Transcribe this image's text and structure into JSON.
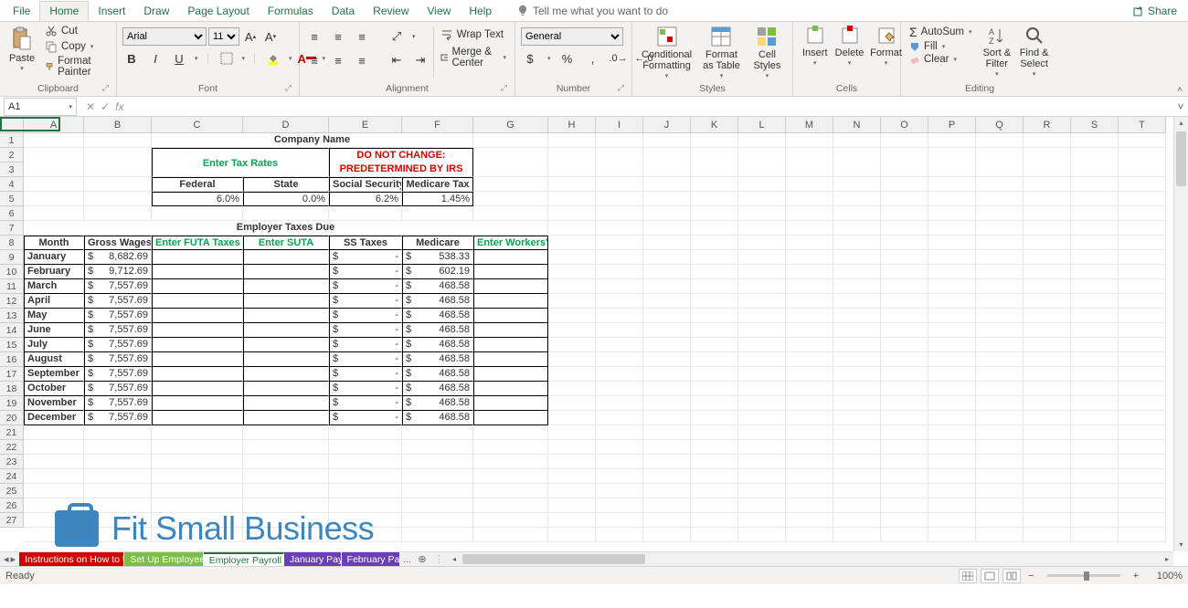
{
  "ribbon": {
    "tabs": [
      "File",
      "Home",
      "Insert",
      "Draw",
      "Page Layout",
      "Formulas",
      "Data",
      "Review",
      "View",
      "Help"
    ],
    "active_tab": "Home",
    "tellme": "Tell me what you want to do",
    "share": "Share",
    "clipboard": {
      "paste": "Paste",
      "cut": "Cut",
      "copy": "Copy",
      "format_painter": "Format Painter",
      "label": "Clipboard"
    },
    "font": {
      "name": "Arial",
      "size": "11",
      "label": "Font"
    },
    "alignment": {
      "wrap": "Wrap Text",
      "merge": "Merge & Center",
      "label": "Alignment"
    },
    "number": {
      "format": "General",
      "label": "Number"
    },
    "styles": {
      "cond": "Conditional Formatting",
      "table": "Format as Table",
      "cellstyles": "Cell Styles",
      "label": "Styles"
    },
    "cells": {
      "insert": "Insert",
      "delete": "Delete",
      "format": "Format",
      "label": "Cells"
    },
    "editing": {
      "autosum": "AutoSum",
      "fill": "Fill",
      "clear": "Clear",
      "sort": "Sort & Filter",
      "find": "Find & Select",
      "label": "Editing"
    }
  },
  "formula_bar": {
    "name_box": "A1",
    "formula": ""
  },
  "columns": [
    "A",
    "B",
    "C",
    "D",
    "E",
    "F",
    "G",
    "H",
    "I",
    "J",
    "K",
    "L",
    "M",
    "N",
    "O",
    "P",
    "Q",
    "R",
    "S",
    "T"
  ],
  "row_count": 27,
  "sheet": {
    "title": "Company Name",
    "enter_rates": "Enter Tax Rates",
    "no_change_1": "DO NOT CHANGE:",
    "no_change_2": "PREDETERMINED BY IRS",
    "headers": {
      "federal": "Federal",
      "state": "State",
      "ss": "Social Security",
      "medicare": "Medicare Tax"
    },
    "rates": {
      "federal": "6.0%",
      "state": "0.0%",
      "ss": "6.2%",
      "medicare": "1.45%"
    },
    "table_title": "Employer Taxes Due",
    "cols": {
      "month": "Month",
      "gross": "Gross Wages",
      "futa": "Enter FUTA Taxes",
      "suta": "Enter SUTA",
      "sstax": "SS Taxes",
      "med": "Medicare",
      "workers": "Enter Workers'"
    },
    "rows": [
      {
        "month": "January",
        "gross": "8,682.69",
        "ss": "-",
        "med": "538.33"
      },
      {
        "month": "February",
        "gross": "9,712.69",
        "ss": "-",
        "med": "602.19"
      },
      {
        "month": "March",
        "gross": "7,557.69",
        "ss": "-",
        "med": "468.58"
      },
      {
        "month": "April",
        "gross": "7,557.69",
        "ss": "-",
        "med": "468.58"
      },
      {
        "month": "May",
        "gross": "7,557.69",
        "ss": "-",
        "med": "468.58"
      },
      {
        "month": "June",
        "gross": "7,557.69",
        "ss": "-",
        "med": "468.58"
      },
      {
        "month": "July",
        "gross": "7,557.69",
        "ss": "-",
        "med": "468.58"
      },
      {
        "month": "August",
        "gross": "7,557.69",
        "ss": "-",
        "med": "468.58"
      },
      {
        "month": "September",
        "gross": "7,557.69",
        "ss": "-",
        "med": "468.58"
      },
      {
        "month": "October",
        "gross": "7,557.69",
        "ss": "-",
        "med": "468.58"
      },
      {
        "month": "November",
        "gross": "7,557.69",
        "ss": "-",
        "med": "468.58"
      },
      {
        "month": "December",
        "gross": "7,557.69",
        "ss": "-",
        "med": "468.58"
      }
    ]
  },
  "sheet_tabs": [
    {
      "label": "Instructions on How to Use----->",
      "color": "#d40000"
    },
    {
      "label": "Set Up Employee Data",
      "color": "#7bc043"
    },
    {
      "label": "Employer Payroll Taxes",
      "color": "#b6e38a",
      "active": true
    },
    {
      "label": "January Payroll",
      "color": "#6a3fb5"
    },
    {
      "label": "February Payrol",
      "color": "#6a3fb5"
    }
  ],
  "tab_more": "...",
  "status": {
    "ready": "Ready",
    "zoom": "100%"
  },
  "watermark": "Fit Small Business"
}
